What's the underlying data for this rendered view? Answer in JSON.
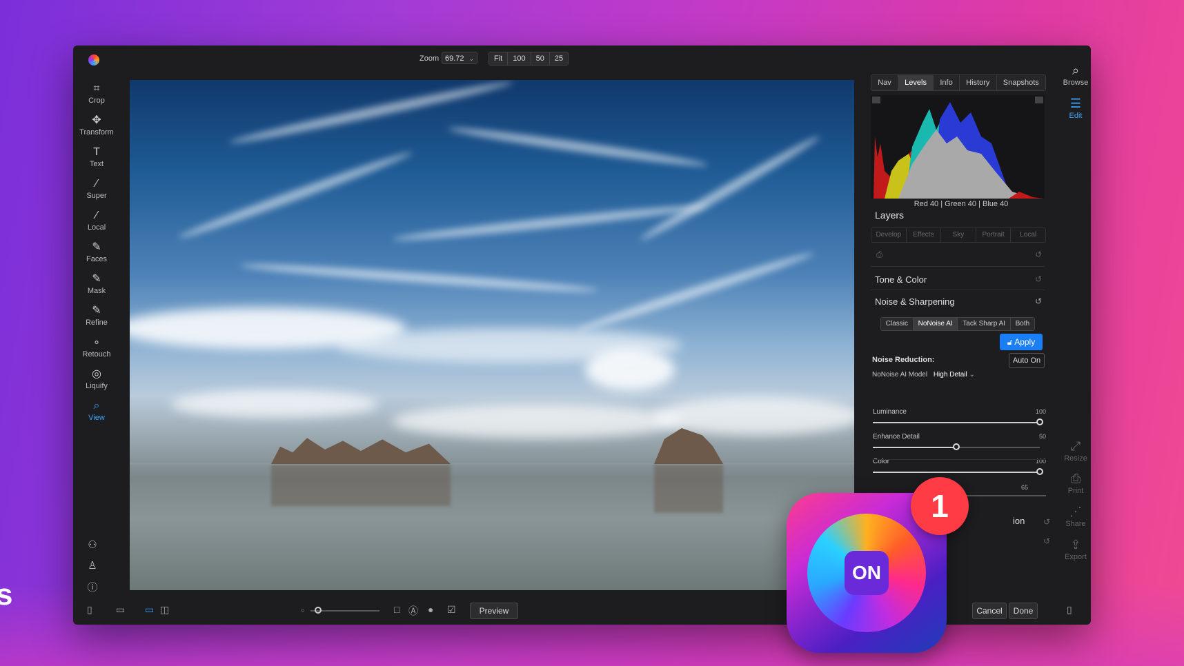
{
  "toolbar": {
    "zoom_label": "Zoom",
    "zoom_value": "69.72",
    "zoom_presets": [
      "Fit",
      "100",
      "50",
      "25"
    ]
  },
  "tools": [
    {
      "label": "Crop",
      "icon": "crop-icon",
      "glyph": "⌗"
    },
    {
      "label": "Transform",
      "icon": "move-icon",
      "glyph": "✥"
    },
    {
      "label": "Text",
      "icon": "text-icon",
      "glyph": "T"
    },
    {
      "label": "Super",
      "icon": "wand-icon",
      "glyph": "⁄"
    },
    {
      "label": "Local",
      "icon": "brush-icon",
      "glyph": "⁄"
    },
    {
      "label": "Faces",
      "icon": "face-brush-icon",
      "glyph": "✎"
    },
    {
      "label": "Mask",
      "icon": "mask-brush-icon",
      "glyph": "✎"
    },
    {
      "label": "Refine",
      "icon": "refine-brush-icon",
      "glyph": "✎"
    },
    {
      "label": "Retouch",
      "icon": "retouch-icon",
      "glyph": "∘"
    },
    {
      "label": "Liquify",
      "icon": "fingerprint-icon",
      "glyph": "◎"
    },
    {
      "label": "View",
      "icon": "zoom-icon",
      "glyph": "⌕",
      "active": true
    }
  ],
  "panel": {
    "tabs": [
      "Nav",
      "Levels",
      "Info",
      "History",
      "Snapshots"
    ],
    "selected_tab": "Levels",
    "rgb_readout": "Red  40  | Green  40  | Blue  40",
    "layers_title": "Layers",
    "layer_tabs": [
      "Develop",
      "Effects",
      "Sky",
      "Portrait",
      "Local"
    ],
    "tone_color": "Tone & Color",
    "noise_sharpening": "Noise & Sharpening",
    "nr_modes": [
      "Classic",
      "NoNoise AI",
      "Tack Sharp AI",
      "Both"
    ],
    "nr_selected": "NoNoise AI",
    "apply": "Apply",
    "noise_reduction": "Noise Reduction:",
    "auto_on": "Auto On",
    "model_label": "NoNoise AI Model",
    "model_value": "High Detail",
    "sliders": [
      {
        "label": "Luminance",
        "value": 100
      },
      {
        "label": "Enhance Detail",
        "value": 50
      },
      {
        "label": "Color",
        "value": 100
      }
    ],
    "hidden_value": "65",
    "partial_label": "ion"
  },
  "sidebar_right": {
    "browse": "Browse",
    "edit": "Edit",
    "resize": "Resize",
    "print": "Print",
    "share": "Share",
    "export": "Export"
  },
  "bottom": {
    "preview": "Preview",
    "cancel": "Cancel",
    "done": "Done"
  },
  "overlay": {
    "badge_count": "1",
    "app_mark": "ON"
  },
  "colors": {
    "accent": "#1a7ef5",
    "active_tool": "#3aa5ff",
    "badge": "#ff3c45"
  }
}
